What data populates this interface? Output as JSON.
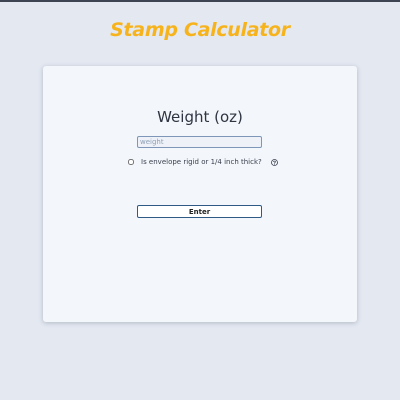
{
  "app": {
    "title": "Stamp Calculator",
    "title_color": "#f7b31b"
  },
  "form": {
    "heading": "Weight (oz)",
    "weight_input": {
      "placeholder": "weight",
      "value": ""
    },
    "rigid_checkbox": {
      "label": "Is envelope rigid or 1/4 inch thick?",
      "checked": false
    },
    "help_icon": "question-circle-icon",
    "enter_button_label": "Enter"
  },
  "colors": {
    "background": "#e3e8f1",
    "card": "#f3f6fa",
    "button_border": "#2f5a86"
  }
}
